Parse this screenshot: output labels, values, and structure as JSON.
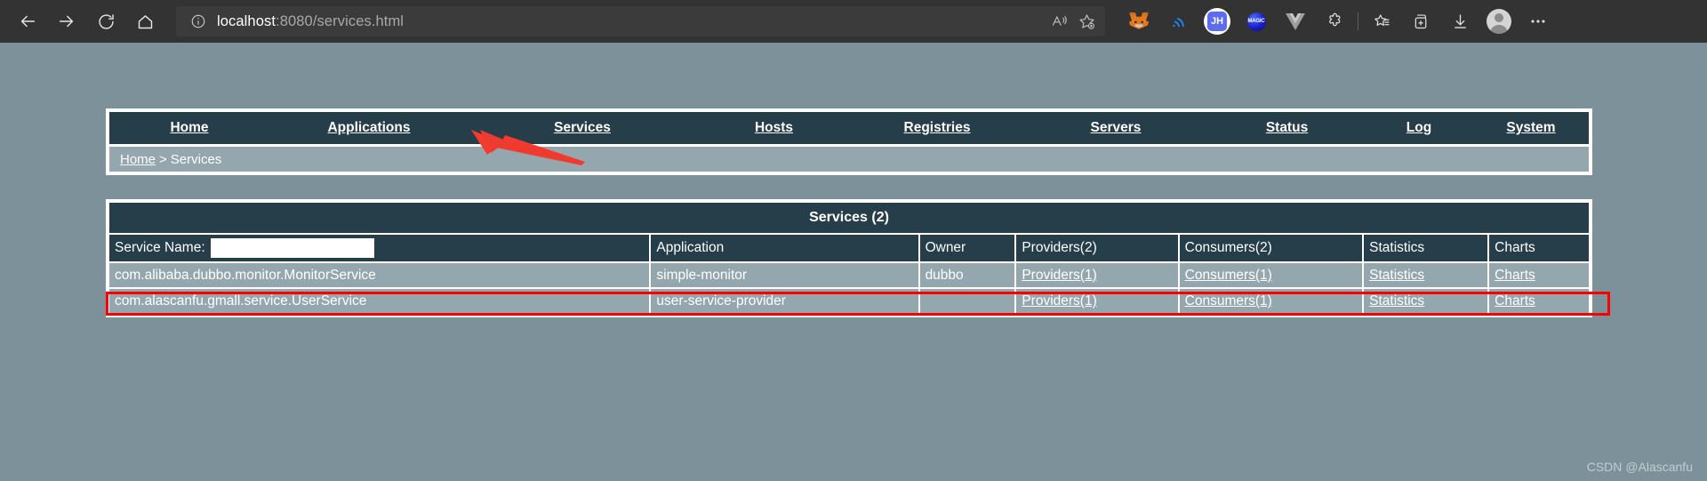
{
  "browser": {
    "back_label": "Back",
    "forward_label": "Forward",
    "refresh_label": "Refresh",
    "home_label": "Home",
    "site_info_label": "View site information",
    "url_host": "localhost",
    "url_rest": ":8080/services.html",
    "read_aloud_label": "Read aloud",
    "favorite_label": "Add this page to favorites",
    "ext_metamask_label": "MetaMask",
    "ext_rss_label": "RSS Feed Reader",
    "ext_jh_label": "JH",
    "ext_jh_text": "JH",
    "ext_magic_label": "Magic",
    "ext_magic_text": "MAGIC",
    "ext_vue_label": "Vue Devtools",
    "ext_puzzle_label": "Extensions",
    "collections_label": "Collections",
    "favorites_bar_label": "Favorites",
    "downloads_label": "Downloads",
    "profile_label": "Profile",
    "settings_label": "Settings and more"
  },
  "nav": {
    "items": [
      {
        "label": "Home",
        "cls": "m-home"
      },
      {
        "label": "Applications",
        "cls": "m-applications"
      },
      {
        "label": "Services",
        "cls": "m-services"
      },
      {
        "label": "Hosts",
        "cls": "m-hosts"
      },
      {
        "label": "Registries",
        "cls": "m-registries"
      },
      {
        "label": "Servers",
        "cls": "m-servers"
      },
      {
        "label": "Status",
        "cls": "m-status"
      },
      {
        "label": "Log",
        "cls": "m-log"
      },
      {
        "label": "System",
        "cls": "m-system"
      }
    ]
  },
  "breadcrumb": {
    "home": "Home",
    "separator": ">",
    "current": "Services"
  },
  "table": {
    "title": "Services (2)",
    "search_label": "Service Name:",
    "search_value": "",
    "search_placeholder": "",
    "headers": {
      "application": "Application",
      "owner": "Owner",
      "providers": "Providers(2)",
      "consumers": "Consumers(2)",
      "statistics": "Statistics",
      "charts": "Charts"
    },
    "rows": [
      {
        "service": "com.alibaba.dubbo.monitor.MonitorService",
        "application": "simple-monitor",
        "owner": "dubbo",
        "providers": "Providers(1)",
        "consumers": "Consumers(1)",
        "statistics": "Statistics",
        "charts": "Charts",
        "highlighted": false
      },
      {
        "service": "com.alascanfu.gmall.service.UserService",
        "application": "user-service-provider",
        "owner": "",
        "providers": "Providers(1)",
        "consumers": "Consumers(1)",
        "statistics": "Statistics",
        "charts": "Charts",
        "highlighted": true
      }
    ]
  },
  "annotations": {
    "arrow_target": "Services",
    "highlight_row": "com.alascanfu.gmall.service.UserService"
  },
  "watermark": "CSDN @Alascanfu",
  "colors": {
    "header_dark": "#263d4a",
    "row_bg": "#94a7ae",
    "page_bg": "#7c9199",
    "annotation_red": "#ff0000"
  }
}
